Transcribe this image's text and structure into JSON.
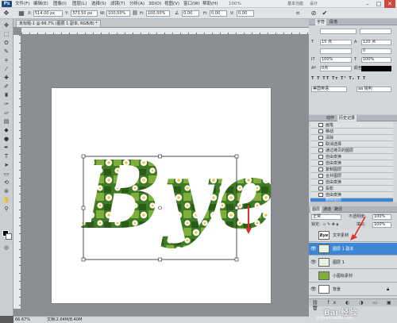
{
  "menubar": {
    "logo": "Ps",
    "items": [
      "文件(F)",
      "编辑(E)",
      "图像(I)",
      "图层(L)",
      "选择(S)",
      "滤镜(T)",
      "分析(A)",
      "3D(D)",
      "视图(V)",
      "窗口(W)",
      "帮助(H)"
    ],
    "zoom": "100%",
    "workspace": "基本功能",
    "design": "设计",
    "window_controls": [
      "–",
      "□",
      "✕"
    ]
  },
  "optionsbar": {
    "x_label": "X:",
    "x_value": "514.00 px",
    "y_label": "Y:",
    "y_value": "373.50 px",
    "w_label": "W:",
    "w_value": "100.00%",
    "h_label": "H:",
    "h_value": "100.00%",
    "angle_value": "0.00",
    "hskew_label": "H:",
    "hskew_value": "0.00",
    "vskew_label": "V:",
    "vskew_value": "0.00"
  },
  "document": {
    "tab_title": "未标题-1 @ 66.7% (图层 1 副本, RGB/8) *",
    "status_zoom": "66.67%",
    "status_doc": "文档:2.64M/8.40M"
  },
  "canvas_art": {
    "text": "Bye",
    "arrow_color": "#e0302b"
  },
  "panels": {
    "char_tabs": [
      "字符",
      "段落"
    ],
    "font_size": "15 点",
    "leading": "120 点",
    "tracking": "0",
    "scale_v": "100%",
    "scale_h": "100%",
    "baseline": "0点",
    "color_label": "颜色:",
    "lang": "美国英语",
    "aa": "aa 锐利",
    "history_tabs": [
      "动作",
      "历史记录"
    ],
    "history": [
      "画笔",
      "移动",
      "清除",
      "取消选择",
      "通过拷贝的图层",
      "自由变换",
      "自由变换",
      "复制图层",
      "合并图层",
      "自由变换",
      "投影",
      "自由变换",
      "删除图层"
    ],
    "layers_tabs": [
      "图层",
      "通道",
      "路径"
    ],
    "blend_mode": "正常",
    "opacity_label": "不透明度:",
    "opacity_value": "100%",
    "lock_label": "锁定:",
    "fill_label": "填充:",
    "fill_value": "100%",
    "layers": [
      {
        "name": "文字素材",
        "thumb": "Bye"
      },
      {
        "name": "图层 1 副本",
        "thumb": ""
      },
      {
        "name": "图层 1",
        "thumb": ""
      },
      {
        "name": "小图标素材",
        "thumb": ""
      },
      {
        "name": "背景",
        "thumb": ""
      }
    ]
  },
  "watermark": {
    "brand": "Bai 经验",
    "url": "jingyan.baidu.com"
  }
}
